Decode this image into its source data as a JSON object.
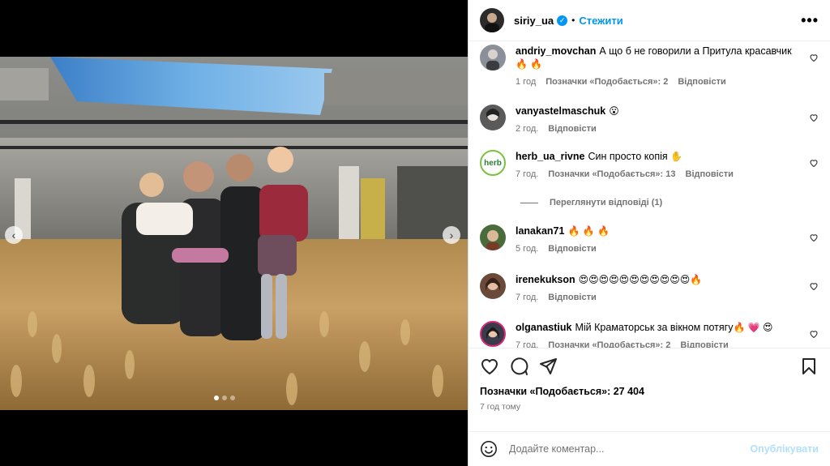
{
  "post": {
    "username": "siriy_ua",
    "separator": "•",
    "follow_label": "Стежити",
    "more_label": "•••",
    "nav_prev": "‹",
    "nav_next": "›",
    "carousel": {
      "count": 3,
      "active": 1
    }
  },
  "comments": [
    {
      "user": "andriy_movchan",
      "text": "А що б не говорили а Притула красавчик",
      "emoji": "🔥 🔥",
      "time": "1 год",
      "likes": "Позначки «Подобається»: 2",
      "reply": "Відповісти",
      "avatar_color": "#8a8f9a"
    },
    {
      "user": "vanyastelmaschuk",
      "text": "",
      "emoji": "😮",
      "time": "2 год.",
      "likes": "",
      "reply": "Відповісти",
      "avatar_color": "#5a5a5a"
    },
    {
      "user": "herb_ua_rivne",
      "text": "Син просто копія",
      "emoji": "✋",
      "time": "7 год.",
      "likes": "Позначки «Подобається»: 13",
      "reply": "Відповісти",
      "avatar_color": "#ffffff",
      "avatar_text": "herb"
    },
    {
      "user": "lanakan71",
      "text": "",
      "emoji": "🔥 🔥 🔥",
      "time": "5 год.",
      "likes": "",
      "reply": "Відповісти",
      "avatar_color": "#4a6b3a"
    },
    {
      "user": "irenekukson",
      "text": "",
      "emoji": "😍😍😍😍😍😍😍😍😍😍😍🔥",
      "time": "7 год.",
      "likes": "",
      "reply": "Відповісти",
      "avatar_color": "#6b4a3a"
    },
    {
      "user": "olganastiuk",
      "text": "Мій Краматорськ за вікном потягу",
      "emoji": "🔥 💗 😍",
      "time": "7 год.",
      "likes": "Позначки «Подобається»: 2",
      "reply": "Відповісти",
      "avatar_color": "#3a3a4a"
    }
  ],
  "view_replies": "Переглянути відповіді (1)",
  "likes_total": "Позначки «Подобається»: 27 404",
  "posted_ago": "7 год тому",
  "add_comment": {
    "placeholder": "Додайте коментар...",
    "publish_label": "Опублікувати"
  },
  "colors": {
    "accent": "#0095f6",
    "muted": "#737373",
    "publish_disabled": "#b2dffc"
  }
}
